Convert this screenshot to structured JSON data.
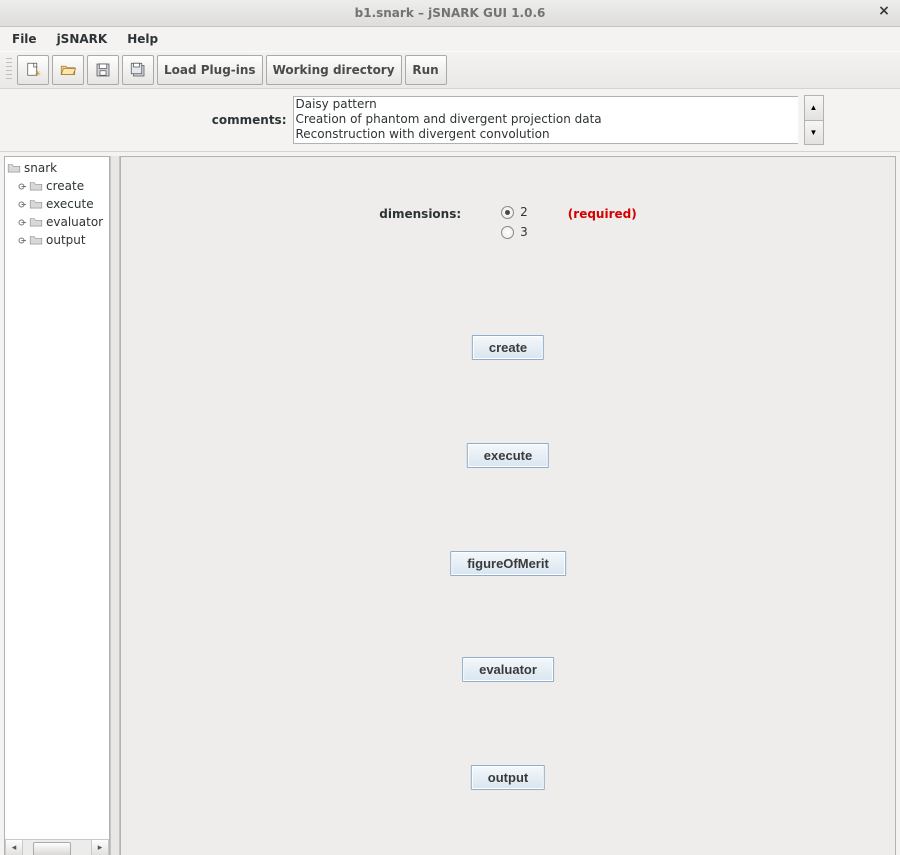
{
  "window": {
    "title": "b1.snark – jSNARK GUI 1.0.6"
  },
  "menubar": {
    "items": [
      "File",
      "jSNARK",
      "Help"
    ]
  },
  "toolbar": {
    "icons": [
      "new",
      "open",
      "save",
      "save-as"
    ],
    "buttons": {
      "load_plugins": "Load Plug-ins",
      "working_directory": "Working directory",
      "run": "Run"
    }
  },
  "comments": {
    "label": "comments:",
    "lines": [
      "Daisy pattern",
      "Creation of phantom and divergent projection data",
      "Reconstruction with divergent convolution"
    ]
  },
  "tree": {
    "root": "snark",
    "children": [
      "create",
      "execute",
      "evaluator",
      "output"
    ]
  },
  "main": {
    "dimensions": {
      "label": "dimensions:",
      "options": [
        "2",
        "3"
      ],
      "selected": "2",
      "required_text": "(required)"
    },
    "buttons": {
      "create": "create",
      "execute": "execute",
      "figureOfMerit": "figureOfMerit",
      "evaluator": "evaluator",
      "output": "output"
    }
  }
}
